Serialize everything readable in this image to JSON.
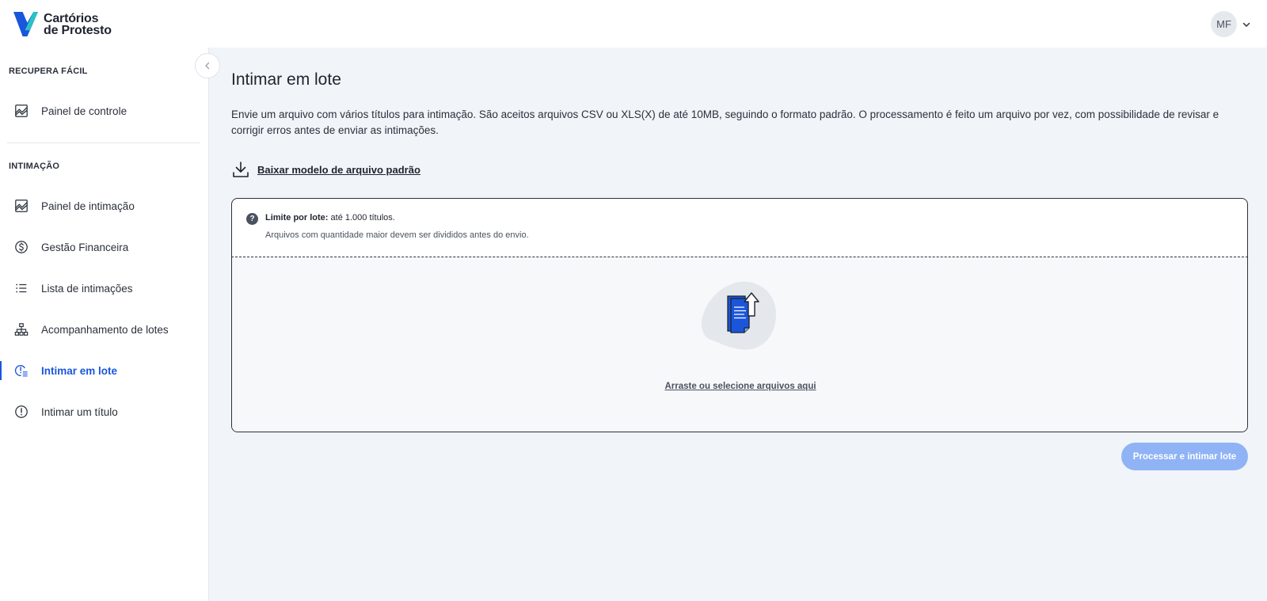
{
  "app": {
    "logo_line1": "Cartórios",
    "logo_line2": "de Protesto",
    "brand_colors": [
      "#1a56db",
      "#27c4c4"
    ]
  },
  "user": {
    "initials": "MF",
    "menu_icon": "chevron-down-icon"
  },
  "sidebar": {
    "sections": [
      {
        "title": "RECUPERA FÁCIL",
        "items": [
          {
            "label": "Painel de controle",
            "icon": "chart-area-icon"
          }
        ]
      },
      {
        "title": "INTIMAÇÃO",
        "items": [
          {
            "label": "Painel de intimação",
            "icon": "chart-area-icon"
          },
          {
            "label": "Gestão Financeira",
            "icon": "dollar-circle-icon"
          },
          {
            "label": "Lista de intimações",
            "icon": "list-icon"
          },
          {
            "label": "Acompanhamento de lotes",
            "icon": "sitemap-icon"
          },
          {
            "label": "Intimar em lote",
            "icon": "batch-alert-icon",
            "active": true
          },
          {
            "label": "Intimar um título",
            "icon": "alert-circle-icon"
          }
        ]
      }
    ],
    "active_color": "#1a56db"
  },
  "main": {
    "title": "Intimar em lote",
    "description": "Envie um arquivo com vários títulos para intimação. São aceitos arquivos CSV ou XLS(X) de até 10MB, seguindo o formato padrão. O processamento é feito um arquivo por vez, com possibilidade de revisar e corrigir erros antes de enviar as intimações.",
    "download_label": "Baixar modelo de arquivo padrão",
    "limit_label": "Limite por lote:",
    "limit_value": "até 1.000 títulos.",
    "limit_note": "Arquivos com quantidade maior devem ser divididos antes do envio.",
    "dropzone_label": "Arraste ou selecione arquivos aqui",
    "submit_label": "Processar e intimar lote",
    "submit_color": "#8fb3f5"
  }
}
